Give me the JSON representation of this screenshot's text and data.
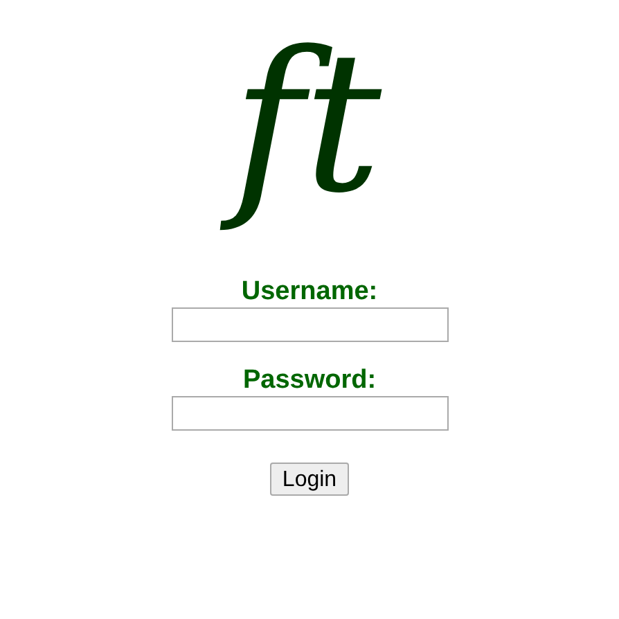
{
  "logo": {
    "text": "ft"
  },
  "fields": [
    {
      "label": "Username:"
    },
    {
      "label": "Password:"
    }
  ],
  "button": {
    "label": "Login"
  }
}
